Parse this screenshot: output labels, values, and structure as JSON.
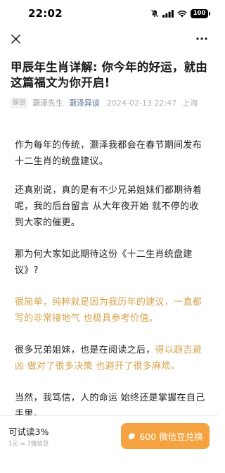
{
  "status_bar": {
    "time": "22:02",
    "battery": "100",
    "icons": [
      "bell-off-icon",
      "signal-icon",
      "wifi-icon",
      "battery-icon"
    ]
  },
  "nav": {
    "close_icon": "close-icon",
    "more_icon": "more-dots-icon"
  },
  "article": {
    "title": "甲辰年生肖详解: 你今年的好运，就由这篇福文为你开启!",
    "badge": "原创",
    "author": "灏泽先生",
    "account": "灏泽异谈",
    "time": "2024-02-13 22:47",
    "location": "上海",
    "paragraphs": [
      {
        "text": "作为每年的传统，灏泽我都会在春节期间发布十二生肖的统盘建议。"
      },
      {
        "text": "还真别说，真的是有不少兄弟姐妹们都期待着呢，我的后台留言 从大年夜开始 就不停的收到大家的催更。"
      },
      {
        "text": "那为何大家如此期待这份《十二生肖统盘建议》?"
      },
      {
        "text": "很简单，纯粹就是因为我历年的建议，一直都写的非常接地气 也极具参考价值。"
      },
      {
        "text_before": "很多兄弟姐妹，也是在阅读之后，",
        "text_highlight": "得以趋吉避凶 做对了很多决策 也避开了很多麻烦。"
      },
      {
        "text": "当然，我笃信，人的命运 始终还是掌握在自己手里。"
      }
    ]
  },
  "bottom": {
    "trial_label": "可试读3%",
    "rate_label": "1元 = 7微信豆",
    "buy_label": "600 微信豆兑换",
    "buy_icon": "bean-icon"
  },
  "colors": {
    "highlight": "#d6a24a",
    "account_link": "#576b95",
    "buy_button": "#f5a340"
  }
}
